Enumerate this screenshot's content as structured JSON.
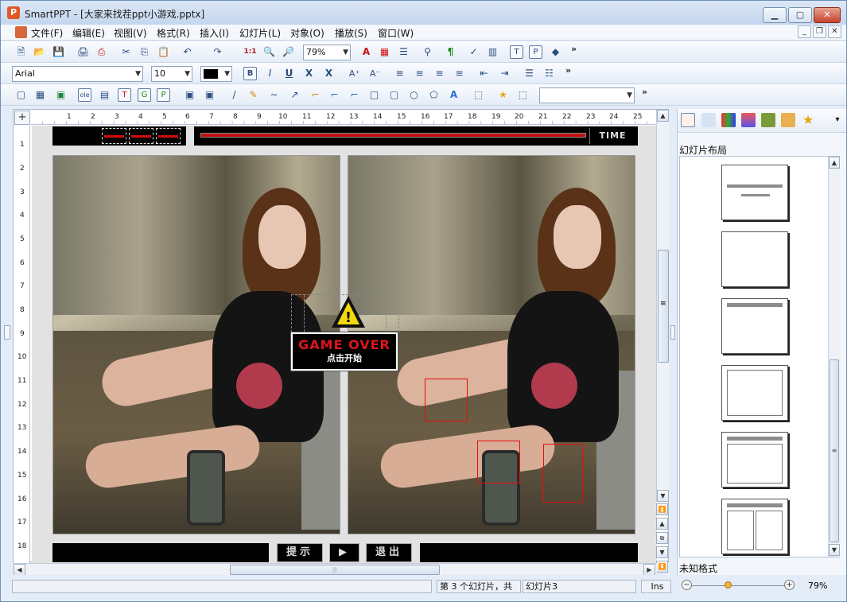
{
  "window": {
    "title": "SmartPPT - [大家来找茬ppt小游戏.pptx]",
    "app_icon": "P"
  },
  "menu": [
    "文件(F)",
    "编辑(E)",
    "视图(V)",
    "格式(R)",
    "插入(I)",
    "幻灯片(L)",
    "对象(O)",
    "播放(S)",
    "窗口(W)"
  ],
  "toolbar": {
    "zoom": "79%",
    "font_name": "Arial",
    "font_size": "10",
    "more": "»",
    "b1": "🗎",
    "b2": "📂",
    "b3": "💾",
    "b4": "🖨",
    "b5": "✂",
    "b6": "⎘",
    "b7": "📋",
    "b8": "↶",
    "b9": "↷",
    "b10": "1:1",
    "b11": "🔍",
    "b12": "🔎",
    "b13": "A",
    "b14": "¶",
    "f1": "B",
    "f2": "I",
    "f3": "U",
    "f4": "X",
    "f5": "X",
    "f6": "A⁺",
    "f7": "A⁻",
    "f8": "≡",
    "f9": "≡",
    "f10": "≡",
    "f11": "≡",
    "f12": "⇤",
    "f13": "⇥",
    "f14": "☰",
    "f15": "☷",
    "d1": "▢",
    "d2": "▦",
    "d3": "▣",
    "d4": "ole",
    "d5": "▤",
    "d6": "T",
    "d7": "G",
    "d8": "P",
    "d9": "▣",
    "d10": "▣",
    "d11": "/",
    "d12": "✎",
    "d13": "∼",
    "d14": "↗",
    "d15": "⌐",
    "d16": "⌐",
    "d17": "⌐",
    "d18": "□",
    "d19": "▢",
    "d20": "○",
    "d21": "⬠",
    "d22": "A",
    "d23": "⬚",
    "d24": "★",
    "d25": "⬚"
  },
  "ruler": {
    "corner": "+",
    "h": [
      "1",
      "2",
      "3",
      "4",
      "5",
      "6",
      "7",
      "8",
      "9",
      "10",
      "11",
      "12",
      "13",
      "14",
      "15",
      "16",
      "17",
      "18",
      "19",
      "20",
      "21",
      "22",
      "23",
      "24",
      "25"
    ],
    "v": [
      "1",
      "2",
      "3",
      "4",
      "5",
      "6",
      "7",
      "8",
      "9",
      "10",
      "11",
      "12",
      "13",
      "14",
      "15",
      "16",
      "17",
      "18"
    ]
  },
  "slide": {
    "time_label": "TIME",
    "game_over": "GAME OVER",
    "game_start": "点击开始",
    "warning_glyph": "!",
    "btn_hint": "提示",
    "btn_play": "▶",
    "btn_exit": "退出"
  },
  "scroll": {
    "up": "▲",
    "down": "▼",
    "left": "◀",
    "right": "▶",
    "grip": "≡",
    "hgrip": "⦙⦙⦙",
    "nav1": "⏫",
    "nav2": "▲",
    "nav3": "⧉",
    "nav4": "▼",
    "nav5": "⏬"
  },
  "right_panel": {
    "title": "幻灯片布局",
    "footer": "未知格式",
    "dropdown": "▾",
    "layouts": [
      "title",
      "blank",
      "title-only",
      "content",
      "title-content",
      "two-content"
    ]
  },
  "status": {
    "cell1": "",
    "slide_info": "第 3 个幻灯片，共",
    "slide_name": "幻灯片3",
    "mode": "Ins",
    "zoom": "79%"
  },
  "colors": {
    "accent": "#e0151b",
    "hit_box": "#e60d0d",
    "chrome": "#e4ecf7"
  }
}
